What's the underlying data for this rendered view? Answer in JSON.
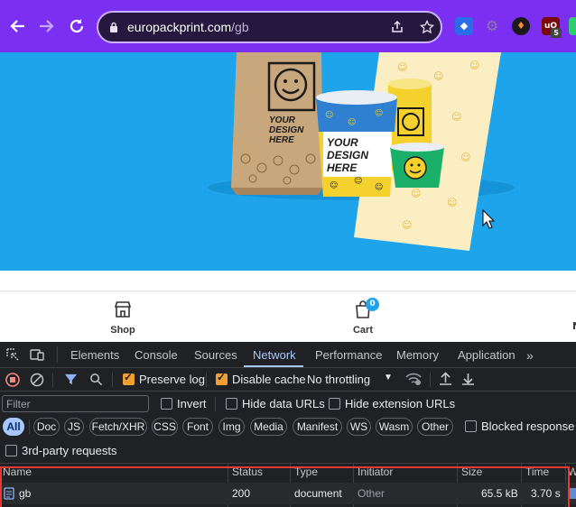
{
  "browser": {
    "url_host": "europackprint.com",
    "url_path": "/gb",
    "ext_badge": "5"
  },
  "hero": {
    "bag_text": "YOUR DESIGN HERE",
    "cup_text": "YOUR DESIGN HERE"
  },
  "bottom_nav": {
    "shop_label": "Shop",
    "cart_label": "Cart",
    "cart_count": "0"
  },
  "devtools": {
    "tabs": [
      "Elements",
      "Console",
      "Sources",
      "Network",
      "Performance",
      "Memory",
      "Application"
    ],
    "active_tab": "Network",
    "preserve_log": "Preserve log",
    "disable_cache": "Disable cache",
    "throttling": "No throttling",
    "filter_placeholder": "Filter",
    "invert": "Invert",
    "hide_data_urls": "Hide data URLs",
    "hide_extension_urls": "Hide extension URLs",
    "type_filters": [
      "All",
      "Doc",
      "JS",
      "Fetch/XHR",
      "CSS",
      "Font",
      "Img",
      "Media",
      "Manifest",
      "WS",
      "Wasm",
      "Other"
    ],
    "blocked_response": "Blocked response co",
    "third_party": "3rd-party requests",
    "columns": {
      "name": "Name",
      "status": "Status",
      "type": "Type",
      "initiator": "Initiator",
      "size": "Size",
      "time": "Time",
      "waterfall": "W"
    },
    "rows": [
      {
        "name": "gb",
        "status": "200",
        "type": "document",
        "initiator": "Other",
        "size": "65.5 kB",
        "time": "3.70 s"
      }
    ]
  },
  "colors": {
    "toolbar": "#7b2ff0",
    "hero_bg": "#1ea4ea",
    "devtools_bg": "#202124",
    "accent": "#a8c7fa",
    "highlight": "#e53935"
  }
}
